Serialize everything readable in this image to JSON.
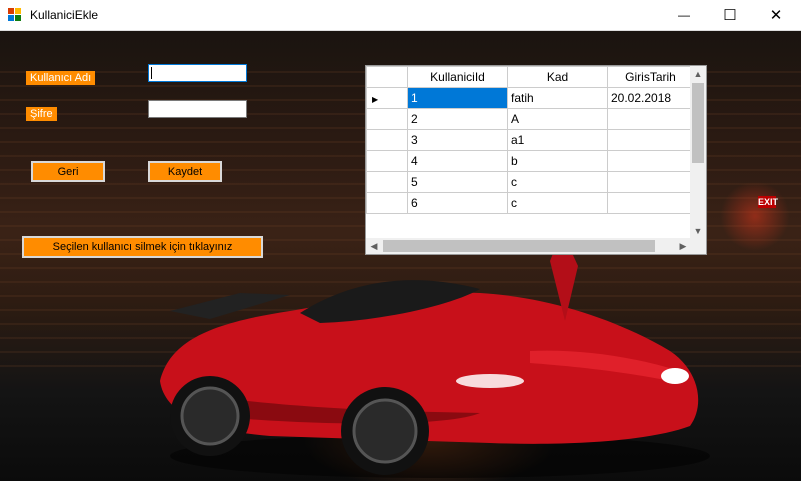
{
  "window": {
    "title": "KullaniciEkle",
    "minimize_glyph": "—",
    "maximize_glyph": "☐",
    "close_glyph": "✕"
  },
  "form": {
    "username_label": "Kullanıcı Adı",
    "password_label": "Şifre",
    "username_value": "",
    "password_value": ""
  },
  "buttons": {
    "back": "Geri",
    "save": "Kaydet",
    "delete_selected": "Seçilen kullanıcı silmek için tıklayınız"
  },
  "grid": {
    "columns": [
      "KullaniciId",
      "Kad",
      "GirisTarih"
    ],
    "rows": [
      [
        "1",
        "fatih",
        "20.02.2018"
      ],
      [
        "2",
        "A",
        ""
      ],
      [
        "3",
        "a1",
        ""
      ],
      [
        "4",
        "b",
        ""
      ],
      [
        "5",
        "c",
        ""
      ],
      [
        "6",
        "c",
        ""
      ]
    ],
    "current_row_glyph": "▶"
  },
  "background": {
    "exit_sign": "EXIT"
  },
  "colors": {
    "accent": "#ff8c00",
    "selection": "#0078d7",
    "car_body": "#c8101a"
  }
}
